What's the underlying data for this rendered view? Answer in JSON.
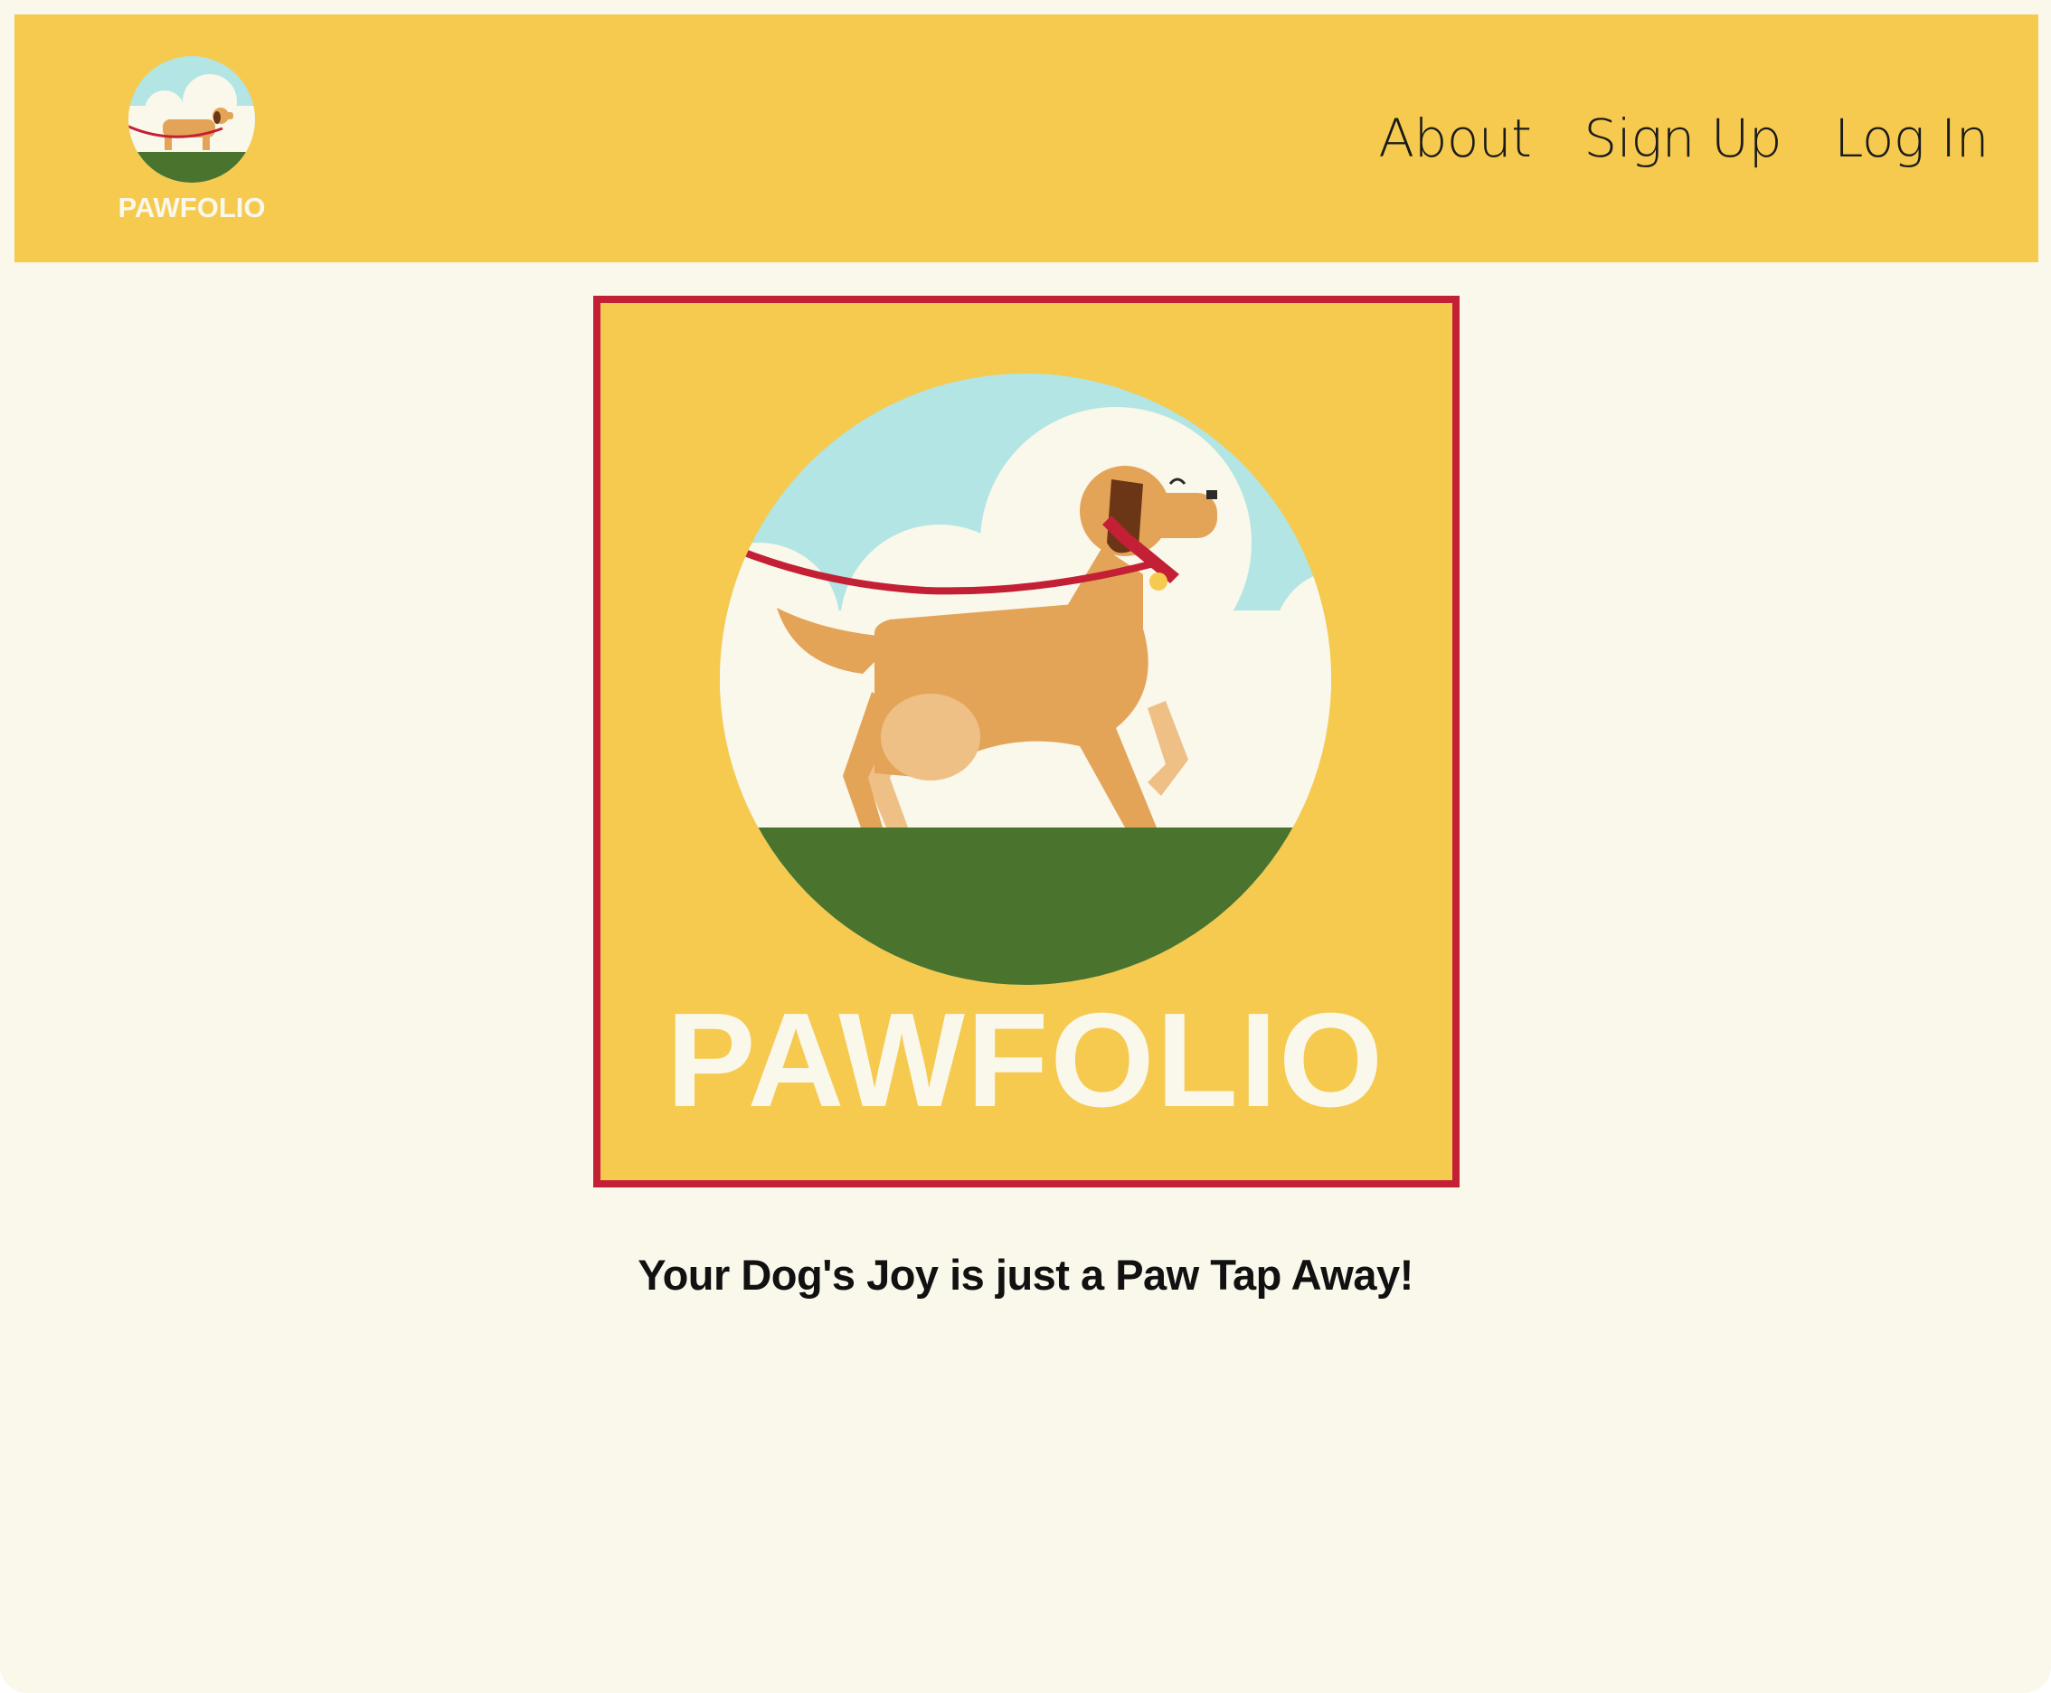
{
  "brand": {
    "name": "PAWFOLIO",
    "logo_icon": "dog-walking-logo-icon"
  },
  "nav": {
    "items": [
      {
        "label": "About"
      },
      {
        "label": "Sign Up"
      },
      {
        "label": "Log In"
      }
    ]
  },
  "hero": {
    "title": "PAWFOLIO",
    "tagline": "Your Dog's Joy is just a Paw Tap Away!"
  },
  "colors": {
    "header_bg": "#f6ca4f",
    "page_bg": "#faf7eb",
    "frame_border": "#c42035",
    "sky": "#b2e5e3",
    "grass": "#4a742d",
    "dog": "#e3a458",
    "leash": "#c42035"
  }
}
